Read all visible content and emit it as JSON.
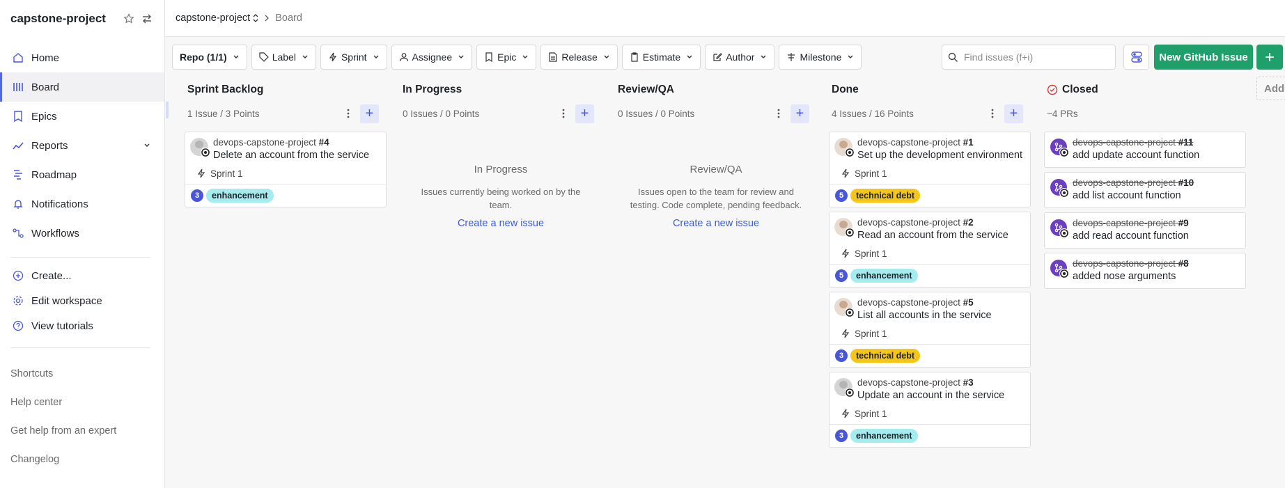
{
  "sidebar": {
    "workspace_title": "capstone-project",
    "nav": [
      {
        "label": "Home",
        "icon": "home-icon"
      },
      {
        "label": "Board",
        "icon": "board-icon",
        "active": true
      },
      {
        "label": "Epics",
        "icon": "epics-icon"
      },
      {
        "label": "Reports",
        "icon": "reports-icon"
      },
      {
        "label": "Roadmap",
        "icon": "roadmap-icon"
      },
      {
        "label": "Notifications",
        "icon": "bell-icon"
      },
      {
        "label": "Workflows",
        "icon": "workflows-icon"
      }
    ],
    "actions": [
      {
        "label": "Create...",
        "icon": "plus-circle-icon"
      },
      {
        "label": "Edit workspace",
        "icon": "gear-icon"
      },
      {
        "label": "View tutorials",
        "icon": "help-circle-icon"
      }
    ],
    "footer": [
      "Shortcuts",
      "Help center",
      "Get help from an expert",
      "Changelog"
    ]
  },
  "breadcrumb": {
    "repo": "capstone-project",
    "page": "Board"
  },
  "filters": [
    "Repo (1/1)",
    "Label",
    "Sprint",
    "Assignee",
    "Epic",
    "Release",
    "Estimate",
    "Author",
    "Milestone"
  ],
  "search": {
    "placeholder": "Find issues (f+i)",
    "value": ""
  },
  "new_issue_label": "New GitHub Issue",
  "add_pipeline_label": "Add",
  "colors": {
    "accent": "#5867e8",
    "green": "#1fa06b",
    "enhancement": "#a5ecef",
    "technical_debt": "#f5c518",
    "pr_purple": "#6c3fc2"
  },
  "columns": {
    "backlog": {
      "title": "Sprint Backlog",
      "summary": "1 Issue / 3 Points",
      "cards": [
        {
          "repo": "devops-capstone-project",
          "number": "#4",
          "title": "Delete an account from the service",
          "sprint": "Sprint 1",
          "estimate": "3",
          "label": "enhancement"
        }
      ]
    },
    "in_progress": {
      "title": "In Progress",
      "summary": "0 Issues / 0 Points",
      "empty_title": "In Progress",
      "empty_desc": "Issues currently being worked on by the team.",
      "empty_link": "Create a new issue"
    },
    "review": {
      "title": "Review/QA",
      "summary": "0 Issues / 0 Points",
      "empty_title": "Review/QA",
      "empty_desc": "Issues open to the team for review and testing. Code complete, pending feedback.",
      "empty_link": "Create a new issue"
    },
    "done": {
      "title": "Done",
      "summary": "4 Issues / 16 Points",
      "cards": [
        {
          "repo": "devops-capstone-project",
          "number": "#1",
          "title": "Set up the development environment",
          "sprint": "Sprint 1",
          "estimate": "5",
          "label": "technical debt"
        },
        {
          "repo": "devops-capstone-project",
          "number": "#2",
          "title": "Read an account from the service",
          "sprint": "Sprint 1",
          "estimate": "5",
          "label": "enhancement"
        },
        {
          "repo": "devops-capstone-project",
          "number": "#5",
          "title": "List all accounts in the service",
          "sprint": "Sprint 1",
          "estimate": "3",
          "label": "technical debt"
        },
        {
          "repo": "devops-capstone-project",
          "number": "#3",
          "title": "Update an account in the service",
          "sprint": "Sprint 1",
          "estimate": "3",
          "label": "enhancement"
        }
      ]
    },
    "closed": {
      "title": "Closed",
      "summary": "~4 PRs",
      "cards": [
        {
          "repo": "devops-capstone-project",
          "number": "#11",
          "title": "add update account function"
        },
        {
          "repo": "devops-capstone-project",
          "number": "#10",
          "title": "add list account function"
        },
        {
          "repo": "devops-capstone-project",
          "number": "#9",
          "title": "add read account function"
        },
        {
          "repo": "devops-capstone-project",
          "number": "#8",
          "title": "added nose arguments"
        }
      ]
    }
  }
}
